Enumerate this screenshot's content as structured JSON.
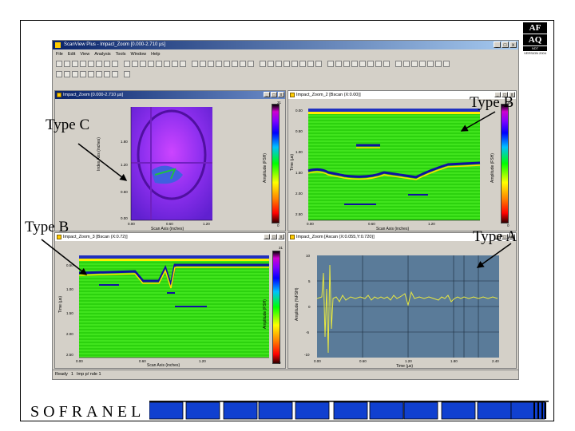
{
  "logo": {
    "line1": "AF",
    "line2": "AQ",
    "line3": "NDT",
    "version": "VERSION 2004"
  },
  "app": {
    "title": "ScanView Plus - Impact_Zoom [0.000-2.710 µs]",
    "window_buttons": [
      "_",
      "□",
      "x"
    ],
    "menu": [
      "File",
      "Edit",
      "View",
      "Analysis",
      "Tools",
      "Window",
      "Help"
    ],
    "status_ready": "Ready",
    "status_items": [
      "1",
      "Imp p/ nde 1"
    ]
  },
  "panels": {
    "cscan": {
      "title": "Impact_Zoom [0.000-2.710 µs]",
      "x_label": "Scan Axis (inches)",
      "y_label": "Index Axis (inches)",
      "x_ticks": [
        "0.00",
        "0.60",
        "1.20"
      ],
      "y_ticks": [
        "1.80",
        "1.20",
        "0.60",
        "0.00"
      ],
      "cb_label": "Amplitude (FSH)",
      "cb_top": "31",
      "cb_bottom": "0"
    },
    "bscan_top": {
      "title": "Impact_Zoom_2 [Bscan (X:0.00)]",
      "x_label": "Scan Axis (inches)",
      "y_label": "Time (µs)",
      "x_ticks": [
        "0.00",
        "0.60",
        "1.20"
      ],
      "y_ticks": [
        "0.00",
        "0.50",
        "1.00",
        "1.50",
        "2.00",
        "2.50"
      ],
      "cb_label": "Amplitude (FSH)",
      "cb_top": "31",
      "cb_bottom": "0"
    },
    "bscan_bottom": {
      "title": "Impact_Zoom_3 [Bscan (X:0.72)]",
      "x_label": "Scan Axis (inches)",
      "y_label": "Time (µs)",
      "x_ticks": [
        "0.00",
        "0.60",
        "1.20"
      ],
      "y_ticks": [
        "0.50",
        "1.00",
        "1.50",
        "2.00",
        "2.50"
      ],
      "cb_label": "Amplitude (FSH)",
      "cb_top": "31",
      "cb_bottom": "0"
    },
    "ascan": {
      "title": "Impact_Zoom [Ascan (X:0.055,Y:0.720)]",
      "x_label": "Time (µs)",
      "y_label": "Amplitude (%FSH)",
      "x_ticks": [
        "0.00",
        "0.60",
        "1.20",
        "1.80",
        "2.40"
      ],
      "y_ticks": [
        "10",
        "5",
        "0",
        "-5",
        "-10"
      ]
    }
  },
  "annotations": {
    "type_c": "Type C",
    "type_b_top": "Type B",
    "type_b_left": "Type B",
    "type_a": "Type A"
  },
  "footer": {
    "brand": "SOFRANEL"
  },
  "colors": {
    "titlebar": "#0a246a",
    "window_bg": "#d4d0c8",
    "bscan_green": "#33dd11",
    "cscan_purple": "#8822ee",
    "ascan_bg": "#5a7b99",
    "ascan_trace": "#e8e840",
    "footer_blue": "#1040d0"
  }
}
